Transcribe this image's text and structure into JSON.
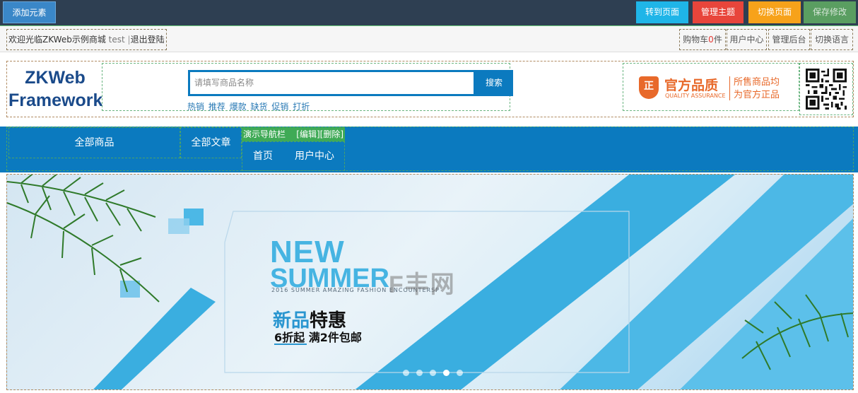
{
  "editor_toolbar": {
    "add_element": "添加元素",
    "goto_page": "转到页面",
    "manage_theme": "管理主题",
    "switch_page": "切换页面",
    "save_changes": "保存修改",
    "colors": {
      "bar": "#2e3f52",
      "add": "#3a87c8",
      "goto": "#1fb5e8",
      "theme": "#e8453b",
      "switch": "#f7a21a",
      "save": "#5a9e61"
    }
  },
  "top_bar": {
    "welcome": "欢迎光临ZKWeb示例商城",
    "username": "test",
    "separator": "|",
    "logout": "退出登陆",
    "cart_label": "购物车",
    "cart_count": "0",
    "cart_unit": "件",
    "user_center": "用户中心",
    "admin": "管理后台",
    "switch_language": "切换语言"
  },
  "header": {
    "logo_line1": "ZKWeb",
    "logo_line2": "Framework",
    "search_placeholder": "请填写商品名称",
    "search_button": "搜索",
    "hot_keywords": [
      "热销",
      "推荐",
      "爆款",
      "缺货",
      "促销",
      "打折"
    ],
    "quality_badge": "正",
    "quality_title": "官方品质",
    "quality_sub": "QUALITY ASSURANCE",
    "quality_desc_line1": "所售商品均",
    "quality_desc_line2": "为官方正品",
    "qr_icon": "qr-code-icon"
  },
  "nav": {
    "all_products": "全部商品",
    "all_articles": "全部文章",
    "demo_navbar_title": "演示导航栏",
    "edit_link": "[编辑]",
    "delete_link": "[删除]",
    "home": "首页",
    "user_center": "用户中心",
    "color": "#0b7abf"
  },
  "banner": {
    "headline1": "NEW",
    "headline2": "SUMMER",
    "subline": "2016 SUMMER AMAZING  FASHION ENCOUNTERSP",
    "promo_cn_part1": "新品",
    "promo_cn_part2": "特惠",
    "promo_detail": "6折起 满2件包邮",
    "watermark": "F丰网",
    "slides_total": 5,
    "active_slide": 4
  }
}
